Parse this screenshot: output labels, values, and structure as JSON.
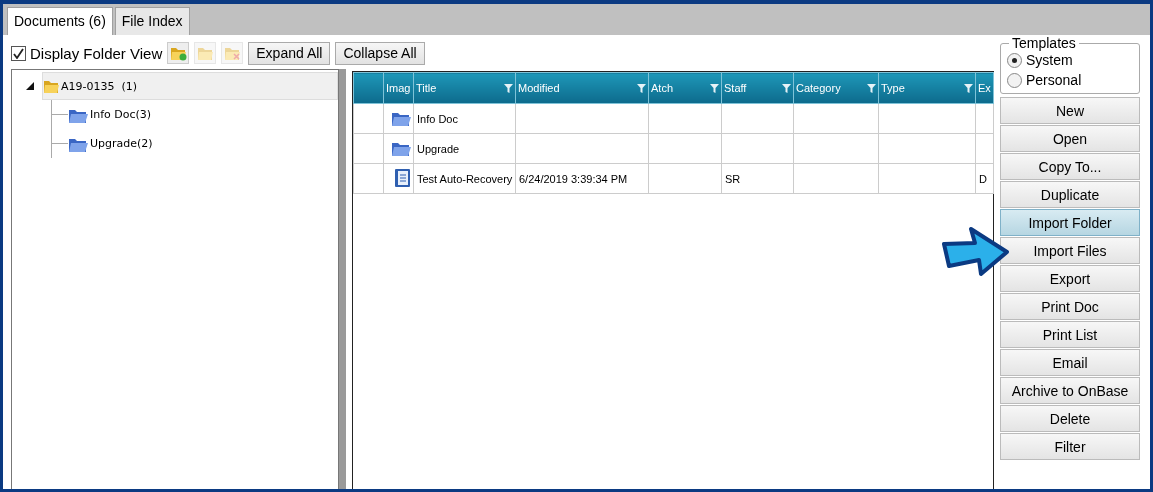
{
  "tabs": [
    {
      "label": "Documents (6)",
      "selected": true
    },
    {
      "label": "File Index",
      "selected": false
    }
  ],
  "toolbar": {
    "display_folder_view": {
      "label": "Display Folder View",
      "checked": true
    },
    "icon_buttons": [
      {
        "kind": "add-folder",
        "disabled": false
      },
      {
        "kind": "folder",
        "disabled": true
      },
      {
        "kind": "delete-folder",
        "disabled": true
      }
    ],
    "buttons": [
      "Expand All",
      "Collapse All"
    ]
  },
  "tree": [
    {
      "label": "A19-0135",
      "count": "(1)",
      "expanded": true,
      "selected": true,
      "children": [
        {
          "label": "Info Doc(3)",
          "selected": false
        },
        {
          "label": "Upgrade(2)",
          "selected": false
        }
      ]
    }
  ],
  "grid": {
    "columns": [
      {
        "filter": false
      },
      {
        "label": "Imag",
        "filter": false
      },
      {
        "label": "Title",
        "filter": true
      },
      {
        "label": "Modified",
        "filter": true
      },
      {
        "label": "Atch",
        "filter": true
      },
      {
        "label": "Staff",
        "filter": true
      },
      {
        "label": "Category",
        "filter": true
      },
      {
        "label": "Type",
        "filter": true
      },
      {
        "label": "Ex",
        "filter": false
      }
    ],
    "rows": [
      {
        "kind": "folder",
        "cells": [
          "",
          "",
          "Info Doc",
          "",
          "",
          "",
          "",
          "",
          ""
        ]
      },
      {
        "kind": "folder",
        "cells": [
          "",
          "",
          "Upgrade",
          "",
          "",
          "",
          "",
          "",
          ""
        ]
      },
      {
        "kind": "document",
        "cells": [
          "",
          "",
          "Test Auto-Recovery",
          "6/24/2019 3:39:34 PM",
          "",
          "SR",
          "",
          "",
          "D"
        ]
      }
    ]
  },
  "templates": {
    "title": "Templates",
    "options": [
      {
        "label": "System",
        "selected": true
      },
      {
        "label": "Personal",
        "selected": false
      }
    ]
  },
  "actions": [
    {
      "label": "New",
      "highlighted": false
    },
    {
      "label": "Open",
      "highlighted": false
    },
    {
      "label": "Copy To...",
      "highlighted": false
    },
    {
      "label": "Duplicate",
      "highlighted": false
    },
    {
      "label": "Import Folder",
      "highlighted": true
    },
    {
      "label": "Import Files",
      "highlighted": false
    },
    {
      "label": "Export",
      "highlighted": false
    },
    {
      "label": "Print Doc",
      "highlighted": false
    },
    {
      "label": "Print List",
      "highlighted": false
    },
    {
      "label": "Email",
      "highlighted": false
    },
    {
      "label": "Archive to OnBase",
      "highlighted": false
    },
    {
      "label": "Delete",
      "highlighted": false
    },
    {
      "label": "Filter",
      "highlighted": false
    }
  ],
  "callout": {
    "kind": "arrow"
  }
}
